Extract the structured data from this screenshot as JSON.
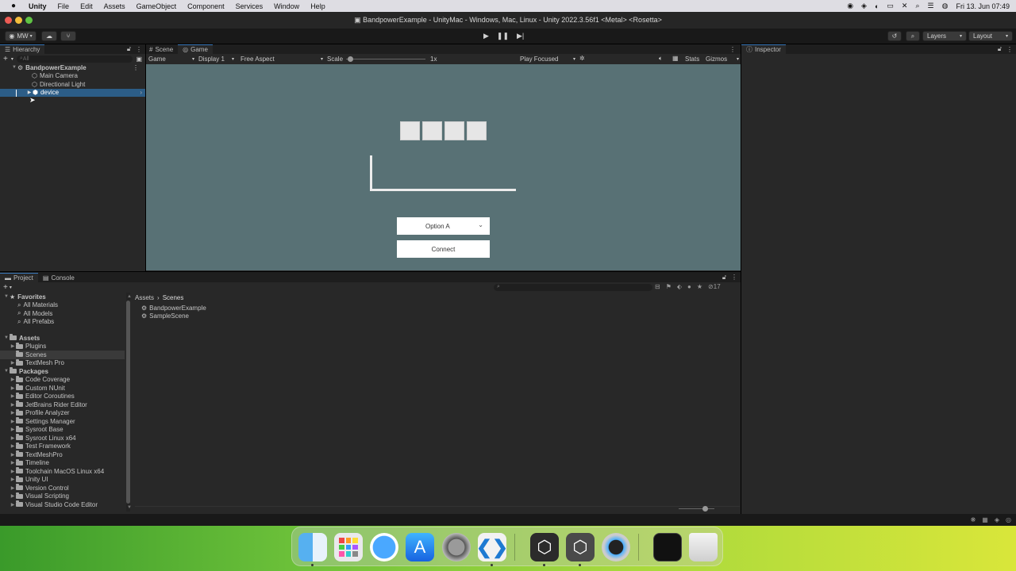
{
  "menubar": {
    "apple": "",
    "items": [
      "Unity",
      "File",
      "Edit",
      "Assets",
      "GameObject",
      "Component",
      "Services",
      "Window",
      "Help"
    ],
    "clock": "Fri 13. Jun  07:49"
  },
  "window": {
    "title": "BandpowerExample - UnityMac - Windows, Mac, Linux - Unity 2022.3.56f1 <Metal> <Rosetta>"
  },
  "toolbar": {
    "account": "MW",
    "layers": "Layers",
    "layout": "Layout"
  },
  "hierarchy": {
    "tab": "Hierarchy",
    "search_placeholder": "All",
    "scene": "BandpowerExample",
    "items": [
      "Main Camera",
      "Directional Light",
      "device"
    ]
  },
  "scene_tabs": [
    "Scene",
    "Game"
  ],
  "game_toolbar": {
    "mode": "Game",
    "display": "Display 1",
    "aspect": "Free Aspect",
    "scale_label": "Scale",
    "scale_value": "1x",
    "play_focused": "Play Focused",
    "stats": "Stats",
    "gizmos": "Gizmos"
  },
  "game": {
    "dropdown": "Option A",
    "connect": "Connect"
  },
  "inspector": {
    "tab": "Inspector"
  },
  "project": {
    "tabs": [
      "Project",
      "Console"
    ],
    "favorites_label": "Favorites",
    "favorites": [
      "All Materials",
      "All Models",
      "All Prefabs"
    ],
    "assets_label": "Assets",
    "assets": [
      "Plugins",
      "Scenes",
      "TextMesh Pro"
    ],
    "packages_label": "Packages",
    "packages": [
      "Code Coverage",
      "Custom NUnit",
      "Editor Coroutines",
      "JetBrains Rider Editor",
      "Profile Analyzer",
      "Settings Manager",
      "Sysroot Base",
      "Sysroot Linux x64",
      "Test Framework",
      "TextMeshPro",
      "Timeline",
      "Toolchain MacOS Linux x64",
      "Unity UI",
      "Version Control",
      "Visual Scripting",
      "Visual Studio Code Editor"
    ],
    "breadcrumb": [
      "Assets",
      "Scenes"
    ],
    "files": [
      "BandpowerExample",
      "SampleScene"
    ],
    "count": "17"
  },
  "colors": {
    "accent": "#3a79bb",
    "game_bg": "#587175",
    "selection": "#2c5d87"
  }
}
